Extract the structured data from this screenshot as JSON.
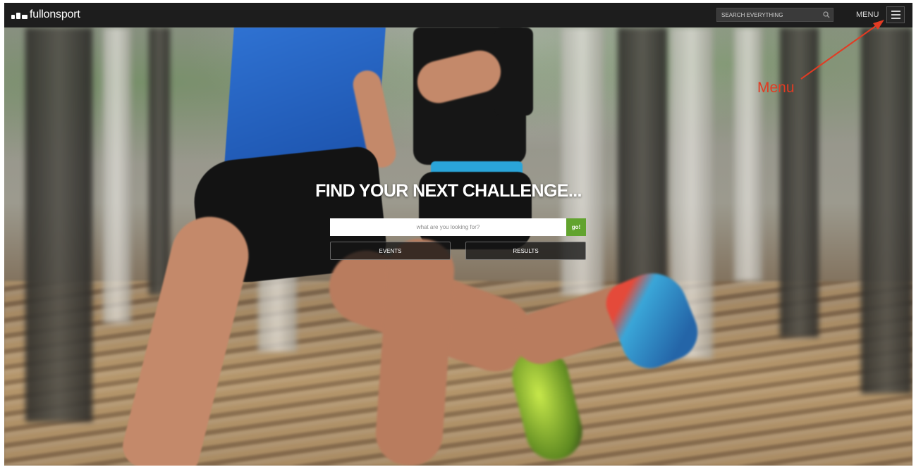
{
  "header": {
    "logo_text": "fullonsport",
    "search_placeholder": "SEARCH EVERYTHING",
    "menu_label": "MENU"
  },
  "hero": {
    "title": "FIND YOUR NEXT CHALLENGE...",
    "search_placeholder": "what are you looking for?",
    "go_label": "go!",
    "events_label": "EVENTS",
    "results_label": "RESULTS"
  },
  "annotation": {
    "label": "Menu"
  },
  "icons": {
    "logo": "fullonsport-logo-icon",
    "search": "search-icon",
    "menu": "hamburger-menu-icon"
  },
  "colors": {
    "topbar": "#1d1d1d",
    "go_button": "#62a32e",
    "annotation": "#e23b23"
  }
}
